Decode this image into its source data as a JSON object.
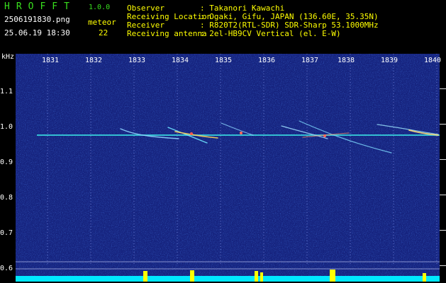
{
  "header": {
    "app_name": "HROFFT",
    "version": "1.0.0",
    "filename": "2506191830.png",
    "meteor_label": "meteor",
    "datetime": "25.06.19 18:30",
    "meteor_count": "22"
  },
  "info": [
    {
      "label": "Observer",
      "value": ": Takanori Kawachi"
    },
    {
      "label": "Receiving Location",
      "value": ": Ogaki, Gifu, JAPAN (136.60E, 35.35N)"
    },
    {
      "label": "Receiver",
      "value": ": R820T2(RTL-SDR) SDR-Sharp 53.1000MHz"
    },
    {
      "label": "Receiving antenna",
      "value": ": 2el-HB9CV Vertical (el. E-W)"
    }
  ],
  "axis": {
    "y_unit": "kHz",
    "y_ticks": [
      "1.1",
      "1.0",
      "0.9",
      "0.8",
      "0.7",
      "0.6"
    ],
    "x_ticks": [
      "1831",
      "1832",
      "1833",
      "1834",
      "1835",
      "1836",
      "1837",
      "1838",
      "1839",
      "1840"
    ]
  },
  "colors": {
    "background": "#14227a",
    "carrier": "#39d9e0",
    "title": "#39e01e",
    "label": "#ffff00",
    "level": "#00e8ff"
  }
}
